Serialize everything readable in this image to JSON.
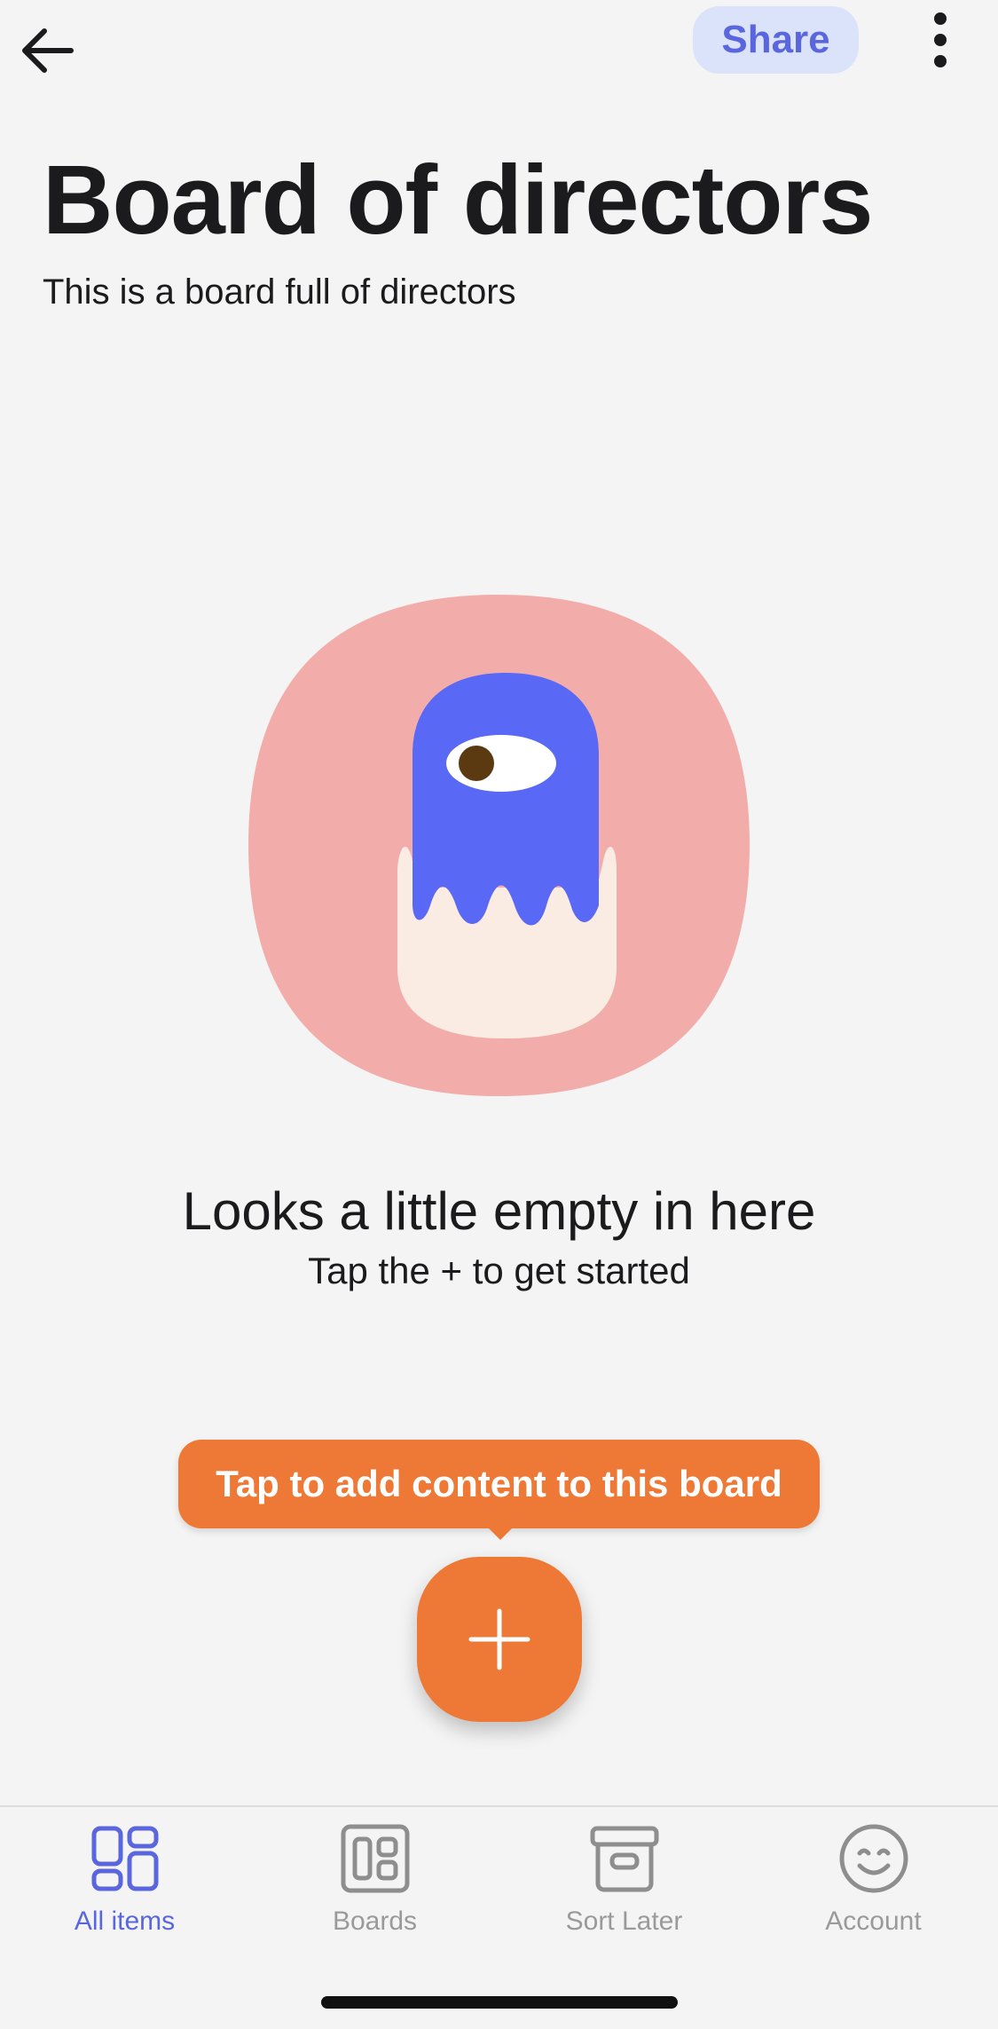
{
  "header": {
    "share_label": "Share"
  },
  "board": {
    "title": "Board of directors",
    "description": "This is a board full of directors"
  },
  "empty_state": {
    "title": "Looks a little empty in here",
    "subtitle": "Tap the + to get started"
  },
  "tooltip": {
    "text": "Tap to add content to this board"
  },
  "bottom_nav": {
    "items": [
      {
        "label": "All items",
        "icon": "all-items-icon",
        "active": true
      },
      {
        "label": "Boards",
        "icon": "boards-icon",
        "active": false
      },
      {
        "label": "Sort Later",
        "icon": "archive-box-icon",
        "active": false
      },
      {
        "label": "Account",
        "icon": "smiley-icon",
        "active": false
      }
    ]
  },
  "colors": {
    "accent": "#5a66dd",
    "share_bg": "#dbe3fb",
    "fab": "#ee7936",
    "blob_pink": "#f2adab",
    "monster_blue": "#5969f5",
    "background": "#f4f4f4"
  }
}
